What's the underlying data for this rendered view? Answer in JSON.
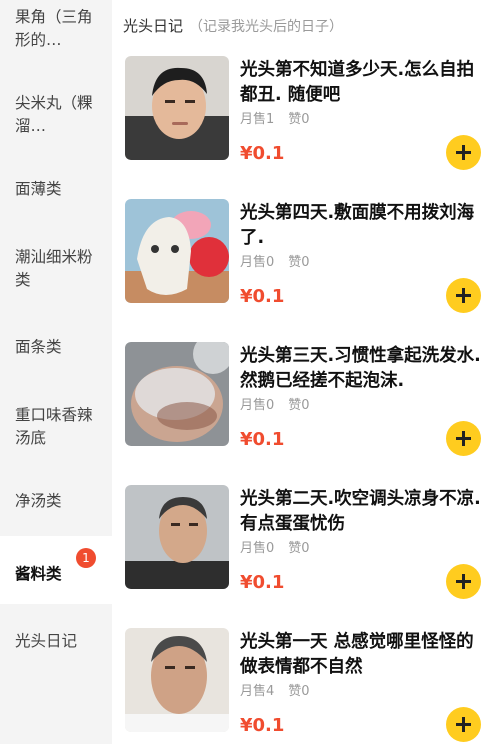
{
  "sidebar": {
    "categories": [
      {
        "label": "果角（三角形的…"
      },
      {
        "label": "尖米丸（粿溜…"
      },
      {
        "label": "面薄类"
      },
      {
        "label": "潮汕细米粉类"
      },
      {
        "label": "面条类"
      },
      {
        "label": "重口味香辣汤底"
      },
      {
        "label": "净汤类"
      },
      {
        "label": "酱料类",
        "badge": "1"
      },
      {
        "label": "光头日记"
      }
    ]
  },
  "section": {
    "title": "光头日记",
    "subtitle": "（记录我光头后的日子）"
  },
  "items": [
    {
      "title": "光头第不知道多少天.怎么自拍都丑. 随便吧",
      "sold": "月售1",
      "likes": "赞0",
      "price": "¥0.1"
    },
    {
      "title": "光头第四天.敷面膜不用拨刘海了.",
      "sold": "月售0",
      "likes": "赞0",
      "price": "¥0.1"
    },
    {
      "title": "光头第三天.习惯性拿起洗发水.然鹅已经搓不起泡沫.",
      "sold": "月售0",
      "likes": "赞0",
      "price": "¥0.1"
    },
    {
      "title": "光头第二天.吹空调头凉身不凉.有点蛋蛋忧伤",
      "sold": "月售0",
      "likes": "赞0",
      "price": "¥0.1"
    },
    {
      "title": "光头第一天 总感觉哪里怪怪的 做表情都不自然",
      "sold": "月售4",
      "likes": "赞0",
      "price": "¥0.1"
    }
  ],
  "colors": {
    "accent_red": "#f04c2f",
    "add_button": "#ffcc1f"
  },
  "icons": {
    "add": "plus-icon"
  }
}
